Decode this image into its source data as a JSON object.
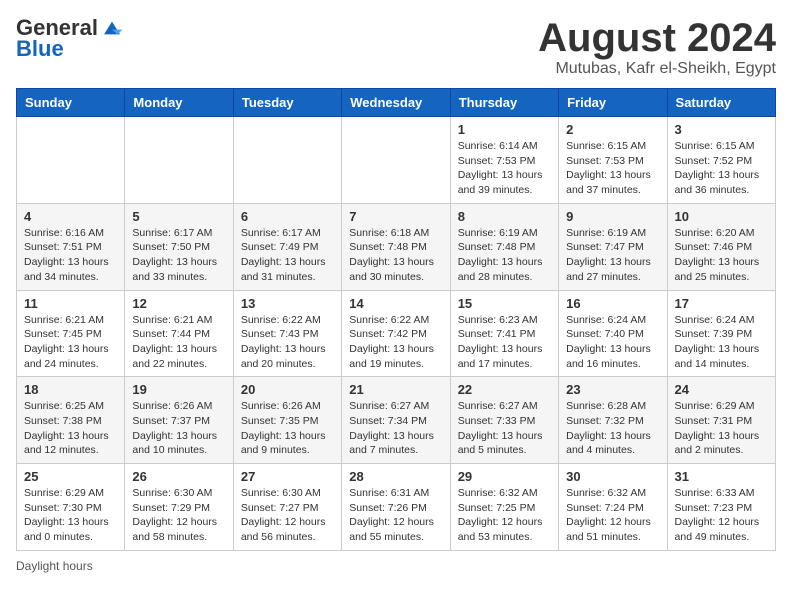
{
  "header": {
    "logo": {
      "general": "General",
      "blue": "Blue"
    },
    "title": "August 2024",
    "subtitle": "Mutubas, Kafr el-Sheikh, Egypt"
  },
  "days_of_week": [
    "Sunday",
    "Monday",
    "Tuesday",
    "Wednesday",
    "Thursday",
    "Friday",
    "Saturday"
  ],
  "weeks": [
    [
      {
        "day": "",
        "info": ""
      },
      {
        "day": "",
        "info": ""
      },
      {
        "day": "",
        "info": ""
      },
      {
        "day": "",
        "info": ""
      },
      {
        "day": "1",
        "info": "Sunrise: 6:14 AM\nSunset: 7:53 PM\nDaylight: 13 hours\nand 39 minutes."
      },
      {
        "day": "2",
        "info": "Sunrise: 6:15 AM\nSunset: 7:53 PM\nDaylight: 13 hours\nand 37 minutes."
      },
      {
        "day": "3",
        "info": "Sunrise: 6:15 AM\nSunset: 7:52 PM\nDaylight: 13 hours\nand 36 minutes."
      }
    ],
    [
      {
        "day": "4",
        "info": "Sunrise: 6:16 AM\nSunset: 7:51 PM\nDaylight: 13 hours\nand 34 minutes."
      },
      {
        "day": "5",
        "info": "Sunrise: 6:17 AM\nSunset: 7:50 PM\nDaylight: 13 hours\nand 33 minutes."
      },
      {
        "day": "6",
        "info": "Sunrise: 6:17 AM\nSunset: 7:49 PM\nDaylight: 13 hours\nand 31 minutes."
      },
      {
        "day": "7",
        "info": "Sunrise: 6:18 AM\nSunset: 7:48 PM\nDaylight: 13 hours\nand 30 minutes."
      },
      {
        "day": "8",
        "info": "Sunrise: 6:19 AM\nSunset: 7:48 PM\nDaylight: 13 hours\nand 28 minutes."
      },
      {
        "day": "9",
        "info": "Sunrise: 6:19 AM\nSunset: 7:47 PM\nDaylight: 13 hours\nand 27 minutes."
      },
      {
        "day": "10",
        "info": "Sunrise: 6:20 AM\nSunset: 7:46 PM\nDaylight: 13 hours\nand 25 minutes."
      }
    ],
    [
      {
        "day": "11",
        "info": "Sunrise: 6:21 AM\nSunset: 7:45 PM\nDaylight: 13 hours\nand 24 minutes."
      },
      {
        "day": "12",
        "info": "Sunrise: 6:21 AM\nSunset: 7:44 PM\nDaylight: 13 hours\nand 22 minutes."
      },
      {
        "day": "13",
        "info": "Sunrise: 6:22 AM\nSunset: 7:43 PM\nDaylight: 13 hours\nand 20 minutes."
      },
      {
        "day": "14",
        "info": "Sunrise: 6:22 AM\nSunset: 7:42 PM\nDaylight: 13 hours\nand 19 minutes."
      },
      {
        "day": "15",
        "info": "Sunrise: 6:23 AM\nSunset: 7:41 PM\nDaylight: 13 hours\nand 17 minutes."
      },
      {
        "day": "16",
        "info": "Sunrise: 6:24 AM\nSunset: 7:40 PM\nDaylight: 13 hours\nand 16 minutes."
      },
      {
        "day": "17",
        "info": "Sunrise: 6:24 AM\nSunset: 7:39 PM\nDaylight: 13 hours\nand 14 minutes."
      }
    ],
    [
      {
        "day": "18",
        "info": "Sunrise: 6:25 AM\nSunset: 7:38 PM\nDaylight: 13 hours\nand 12 minutes."
      },
      {
        "day": "19",
        "info": "Sunrise: 6:26 AM\nSunset: 7:37 PM\nDaylight: 13 hours\nand 10 minutes."
      },
      {
        "day": "20",
        "info": "Sunrise: 6:26 AM\nSunset: 7:35 PM\nDaylight: 13 hours\nand 9 minutes."
      },
      {
        "day": "21",
        "info": "Sunrise: 6:27 AM\nSunset: 7:34 PM\nDaylight: 13 hours\nand 7 minutes."
      },
      {
        "day": "22",
        "info": "Sunrise: 6:27 AM\nSunset: 7:33 PM\nDaylight: 13 hours\nand 5 minutes."
      },
      {
        "day": "23",
        "info": "Sunrise: 6:28 AM\nSunset: 7:32 PM\nDaylight: 13 hours\nand 4 minutes."
      },
      {
        "day": "24",
        "info": "Sunrise: 6:29 AM\nSunset: 7:31 PM\nDaylight: 13 hours\nand 2 minutes."
      }
    ],
    [
      {
        "day": "25",
        "info": "Sunrise: 6:29 AM\nSunset: 7:30 PM\nDaylight: 13 hours\nand 0 minutes."
      },
      {
        "day": "26",
        "info": "Sunrise: 6:30 AM\nSunset: 7:29 PM\nDaylight: 12 hours\nand 58 minutes."
      },
      {
        "day": "27",
        "info": "Sunrise: 6:30 AM\nSunset: 7:27 PM\nDaylight: 12 hours\nand 56 minutes."
      },
      {
        "day": "28",
        "info": "Sunrise: 6:31 AM\nSunset: 7:26 PM\nDaylight: 12 hours\nand 55 minutes."
      },
      {
        "day": "29",
        "info": "Sunrise: 6:32 AM\nSunset: 7:25 PM\nDaylight: 12 hours\nand 53 minutes."
      },
      {
        "day": "30",
        "info": "Sunrise: 6:32 AM\nSunset: 7:24 PM\nDaylight: 12 hours\nand 51 minutes."
      },
      {
        "day": "31",
        "info": "Sunrise: 6:33 AM\nSunset: 7:23 PM\nDaylight: 12 hours\nand 49 minutes."
      }
    ]
  ],
  "footer": {
    "daylight_label": "Daylight hours"
  }
}
